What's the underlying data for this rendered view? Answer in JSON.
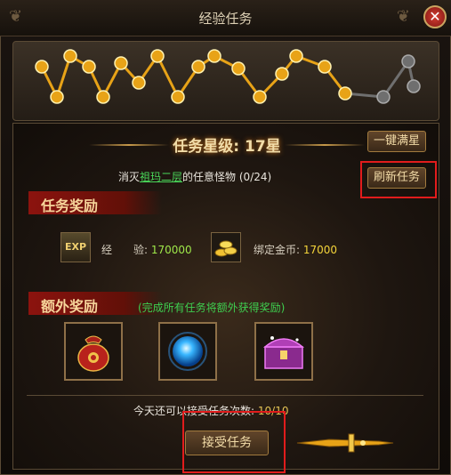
{
  "window": {
    "title": "经验任务",
    "close_symbol": "✕"
  },
  "star_level": {
    "label": "任务星级:",
    "value": "17星"
  },
  "buttons": {
    "one_click_max": "一键满星",
    "refresh_task": "刷新任务",
    "accept_task": "接受任务"
  },
  "mission": {
    "prefix": "消灭",
    "location": "祖玛二层",
    "suffix": "的任意怪物",
    "progress": "(0/24)"
  },
  "rewards": {
    "banner": "任务奖励",
    "exp_icon_text": "EXP",
    "exp_label": "经　　验:",
    "exp_value": "170000",
    "gold_label": "绑定金币:",
    "gold_value": "17000"
  },
  "bonus": {
    "banner": "额外奖励",
    "note": "(完成所有任务将额外获得奖励)",
    "items": [
      "money-bag",
      "blue-orb",
      "treasure-chest"
    ]
  },
  "remaining": {
    "label": "今天还可以接受任务次数:",
    "count": "10/10"
  },
  "star_path": {
    "total": 17,
    "active": 17,
    "shown": 20
  },
  "colors": {
    "accent_gold": "#e8a317",
    "inactive_star": "#6f6f6f",
    "highlight_red": "#e11c1c",
    "green_text": "#4ad85a"
  }
}
